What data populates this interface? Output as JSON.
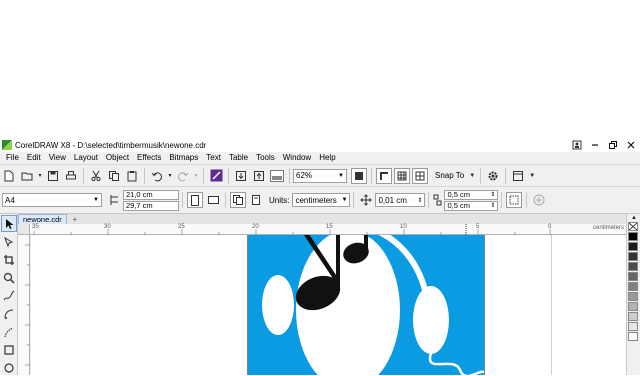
{
  "window": {
    "title": "CorelDRAW X8 - D:\\selected\\timbermusik\\newone.cdr"
  },
  "menu": [
    "File",
    "Edit",
    "View",
    "Layout",
    "Object",
    "Effects",
    "Bitmaps",
    "Text",
    "Table",
    "Tools",
    "Window",
    "Help"
  ],
  "toolbar": {
    "zoom_value": "62%",
    "snap_label": "Snap To"
  },
  "property_bar": {
    "page_size": "A4",
    "width": "21,0 cm",
    "height": "29,7 cm",
    "units_label": "Units:",
    "units_value": "centimeters",
    "nudge": "0,01 cm",
    "dup_x": "0,5 cm",
    "dup_y": "0,5 cm"
  },
  "tabs": {
    "document": "newone.cdr",
    "add": "+"
  },
  "ruler": {
    "units": "centimeters",
    "h_ticks": [
      "35",
      "30",
      "25",
      "20",
      "15",
      "10",
      "5",
      "0"
    ]
  },
  "colors": {
    "artwork_blue": "#0b9be3",
    "accent_green": "#2e8b2e"
  },
  "icons": {
    "win": [
      "help-icon",
      "minimize-icon",
      "restore-icon",
      "close-icon"
    ]
  }
}
